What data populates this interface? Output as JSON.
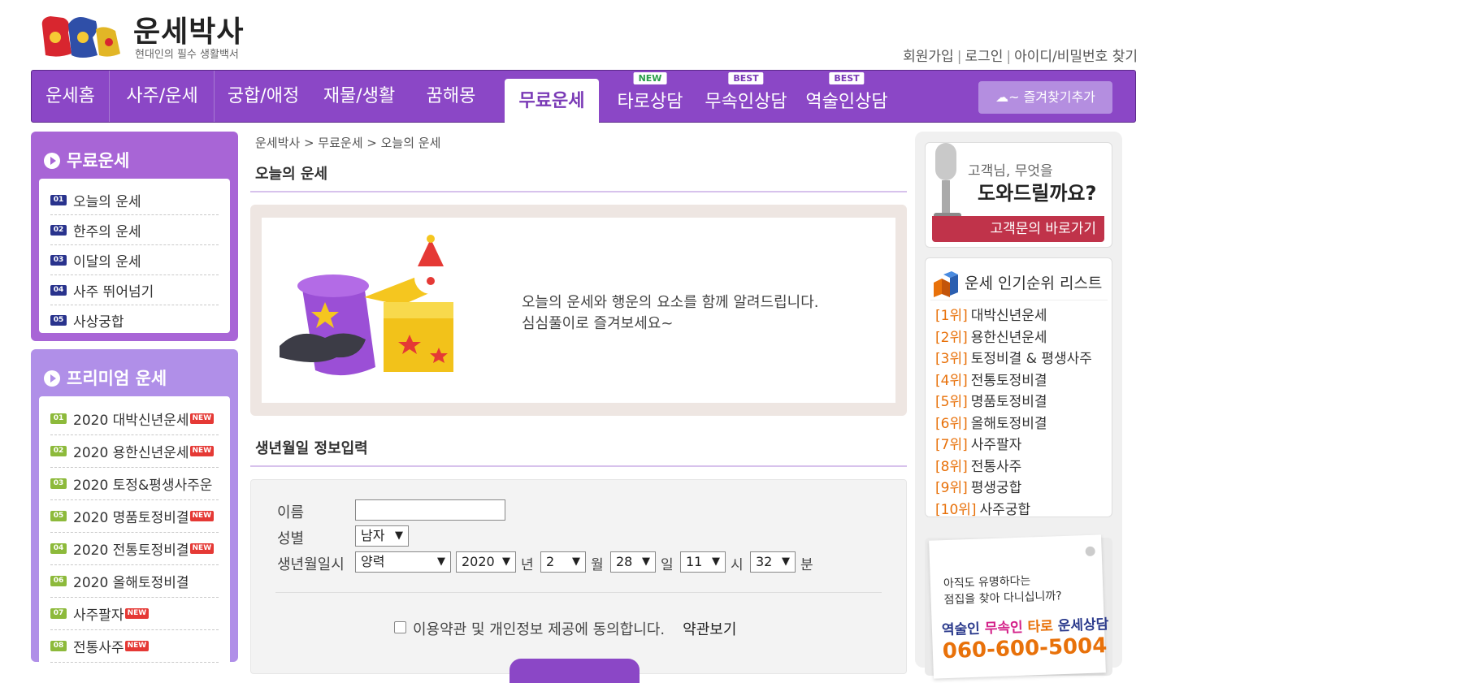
{
  "site": {
    "title": "운세박사",
    "subtitle": "현대인의 필수 생활백서"
  },
  "toplinks": [
    "회원가입",
    "로그인",
    "아이디/비밀번호 찾기"
  ],
  "nav": {
    "items": [
      {
        "label": "운세홈"
      },
      {
        "label": "사주/운세"
      },
      {
        "label": "궁합/애정"
      },
      {
        "label": "재물/생활"
      },
      {
        "label": "꿈해몽"
      },
      {
        "label": "무료운세"
      },
      {
        "label": "타로상담",
        "badge": "NEW"
      },
      {
        "label": "무속인상담",
        "badge": "BEST"
      },
      {
        "label": "역술인상담",
        "badge": "BEST"
      }
    ],
    "active": "무료운세",
    "favorite": "즐겨찾기추가"
  },
  "free_menu": {
    "title": "무료운세",
    "items": [
      {
        "num": "01",
        "label": "오늘의 운세"
      },
      {
        "num": "02",
        "label": "한주의 운세"
      },
      {
        "num": "03",
        "label": "이달의 운세"
      },
      {
        "num": "04",
        "label": "사주 뛰어넘기"
      },
      {
        "num": "05",
        "label": "사상궁합"
      }
    ]
  },
  "premium_menu": {
    "title": "프리미엄 운세",
    "items": [
      {
        "num": "01",
        "label": "2020 대박신년운세",
        "new": "NEW"
      },
      {
        "num": "02",
        "label": "2020 용한신년운세",
        "new": "NEW"
      },
      {
        "num": "03",
        "label": "2020 토정&평생사주운"
      },
      {
        "num": "05",
        "label": "2020 명품토정비결",
        "new": "NEW"
      },
      {
        "num": "04",
        "label": "2020 전통토정비결",
        "new": "NEW"
      },
      {
        "num": "06",
        "label": "2020 올해토정비결"
      },
      {
        "num": "07",
        "label": "사주팔자",
        "new": "NEW"
      },
      {
        "num": "08",
        "label": "전통사주",
        "new": "NEW"
      }
    ]
  },
  "breadcrumb": "운세박사 > 무료운세 > 오늘의 운세",
  "page_title": "오늘의 운세",
  "intro": {
    "line1": "오늘의 운세와 행운의 요소를 함께 알려드립니다.",
    "line2": "심심풀이로 즐겨보세요~"
  },
  "form": {
    "title": "생년월일 정보입력",
    "name_label": "이름",
    "name_value": "",
    "gender_label": "성별",
    "gender_value": "남자",
    "birth_label": "생년월일시",
    "calendar_value": "양력",
    "year_value": "2020",
    "year_unit": "년",
    "month_value": "2",
    "month_unit": "월",
    "day_value": "28",
    "day_unit": "일",
    "hour_value": "11",
    "hour_unit": "시",
    "minute_value": "32",
    "minute_unit": "분",
    "agree_text": "이용약관 및 개인정보 제공에 동의합니다.",
    "terms_link": "약관보기"
  },
  "help": {
    "line1": "고객님, 무엇을",
    "line2": "도와드릴까요?",
    "cta": "고객문의 바로가기"
  },
  "ranking": {
    "title": "운세 인기순위 리스트",
    "items": [
      {
        "rank": "[1위]",
        "label": "대박신년운세"
      },
      {
        "rank": "[2위]",
        "label": "용한신년운세"
      },
      {
        "rank": "[3위]",
        "label": "토정비결 & 평생사주"
      },
      {
        "rank": "[4위]",
        "label": "전통토정비결"
      },
      {
        "rank": "[5위]",
        "label": "명품토정비결"
      },
      {
        "rank": "[6위]",
        "label": "올해토정비결"
      },
      {
        "rank": "[7위]",
        "label": "사주팔자"
      },
      {
        "rank": "[8위]",
        "label": "전통사주"
      },
      {
        "rank": "[9위]",
        "label": "평생궁합"
      },
      {
        "rank": "[10위]",
        "label": "사주궁합"
      }
    ]
  },
  "ad": {
    "line1": "아직도 유명하다는",
    "line2": "점집을 찾아 다니십니까?",
    "w1": "역술인",
    "w2": "무속인",
    "w3": "타로",
    "w4": "운세상담",
    "phone": "060-600-5004"
  },
  "colors": {
    "accent": "#8b47c6",
    "rank": "#e8710a",
    "cta": "#c0334a"
  }
}
